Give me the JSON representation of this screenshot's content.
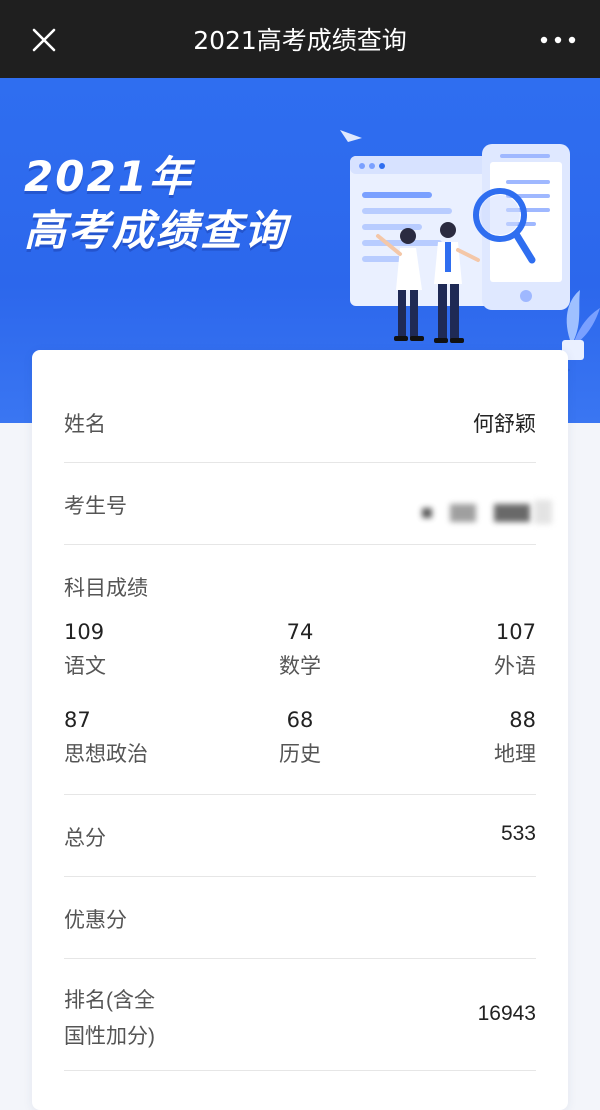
{
  "topbar": {
    "title": "2021高考成绩查询",
    "close_icon": "close-icon",
    "more_icon": "more-icon"
  },
  "banner": {
    "line1": "2021年",
    "line2": "高考成绩查询",
    "colors": {
      "primary": "#2f6ef0",
      "card": "#ffffff"
    }
  },
  "result": {
    "name_label": "姓名",
    "name_value": "何舒颖",
    "exam_id_label": "考生号",
    "subjects_label": "科目成绩",
    "subjects": [
      {
        "score": "109",
        "name": "语文"
      },
      {
        "score": "74",
        "name": "数学"
      },
      {
        "score": "107",
        "name": "外语"
      },
      {
        "score": "87",
        "name": "思想政治"
      },
      {
        "score": "68",
        "name": "历史"
      },
      {
        "score": "88",
        "name": "地理"
      }
    ],
    "total_label": "总分",
    "total_value": "533",
    "bonus_label": "优惠分",
    "rank_label_line1": "排名(含全",
    "rank_label_line2": "国性加分)",
    "rank_value": "16943"
  }
}
